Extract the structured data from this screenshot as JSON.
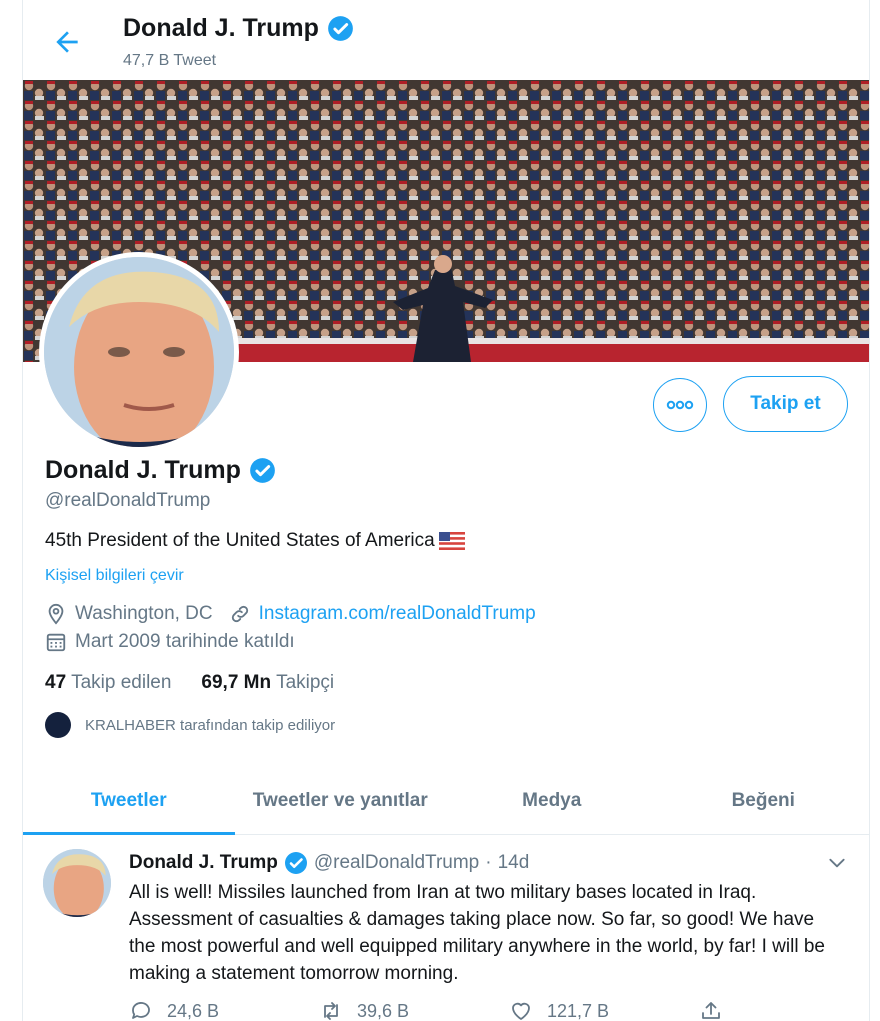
{
  "header": {
    "name": "Donald J. Trump",
    "tweet_count": "47,7 B Tweet"
  },
  "profile": {
    "name": "Donald J. Trump",
    "handle": "@realDonaldTrump",
    "bio": "45th President of the United States of America",
    "translate_label": "Kişisel bilgileri çevir",
    "location": "Washington, DC",
    "website": "Instagram.com/realDonaldTrump",
    "joined": "Mart 2009 tarihinde katıldı",
    "following_count": "47",
    "following_label": "Takip edilen",
    "followers_count": "69,7 Mn",
    "followers_label": "Takipçi",
    "followed_by": "KRALHABER tarafından takip ediliyor"
  },
  "actions": {
    "more_label": "ooo",
    "follow_label": "Takip et"
  },
  "tabs": [
    {
      "label": "Tweetler",
      "active": true
    },
    {
      "label": "Tweetler ve yanıtlar",
      "active": false
    },
    {
      "label": "Medya",
      "active": false
    },
    {
      "label": "Beğeni",
      "active": false
    }
  ],
  "tweet": {
    "name": "Donald J. Trump",
    "handle": "@realDonaldTrump",
    "separator": "·",
    "time": "14d",
    "text": "All is well! Missiles launched from Iran at two military bases located in Iraq. Assessment of casualties & damages taking place now. So far, so good! We have the most powerful and well equipped military anywhere in the world, by far! I will be making a statement tomorrow morning.",
    "replies": "24,6 B",
    "retweets": "39,6 B",
    "likes": "121,7 B"
  },
  "colors": {
    "accent": "#1da1f2",
    "secondary_text": "#657786",
    "border": "#e6ecf0"
  },
  "icons": [
    "back-arrow-icon",
    "verified-badge-icon",
    "location-pin-icon",
    "link-icon",
    "calendar-icon",
    "reply-icon",
    "retweet-icon",
    "like-icon",
    "share-icon",
    "chevron-down-icon",
    "us-flag-icon"
  ]
}
